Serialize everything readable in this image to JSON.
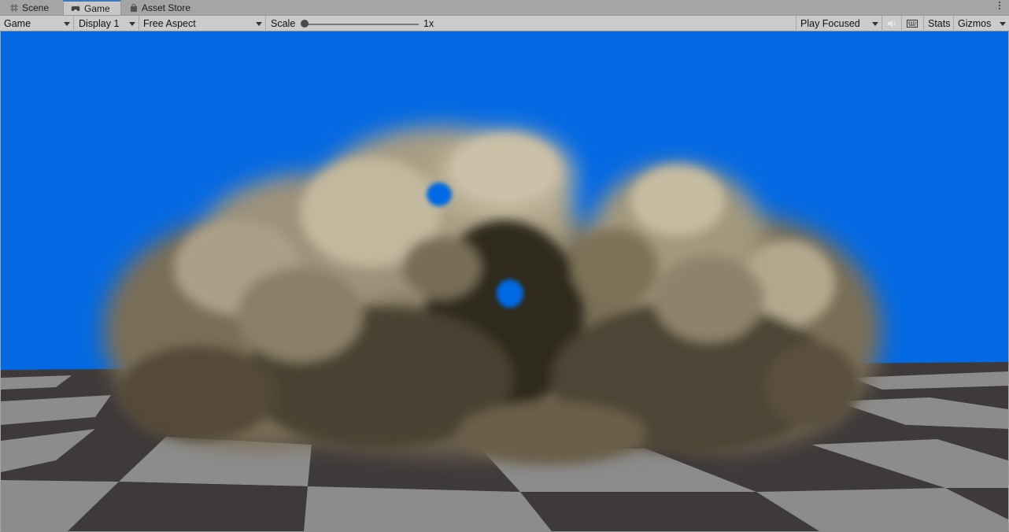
{
  "tabs": [
    {
      "label": "Scene",
      "icon": "grid-icon"
    },
    {
      "label": "Game",
      "icon": "gamepad-icon"
    },
    {
      "label": "Asset Store",
      "icon": "bag-icon"
    }
  ],
  "toolbar": {
    "view_dropdown": "Game",
    "display_dropdown": "Display 1",
    "aspect_dropdown": "Free Aspect",
    "scale_label": "Scale",
    "scale_value": "1x",
    "play_mode_dropdown": "Play Focused",
    "stats_label": "Stats",
    "gizmos_label": "Gizmos"
  },
  "colors": {
    "sky": "#0369e3",
    "cloud_light": "#cfc5ad",
    "cloud_dark": "#2f2a1e",
    "floor_light": "#8c8c8c",
    "floor_dark": "#3e3a3a"
  }
}
